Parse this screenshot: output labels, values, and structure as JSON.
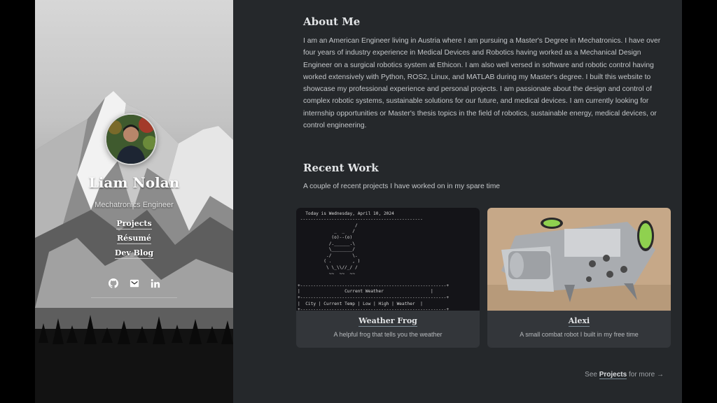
{
  "profile": {
    "name": "Liam Nolan",
    "role": "Mechatronics Engineer"
  },
  "nav": {
    "items": [
      {
        "label": "Projects"
      },
      {
        "label": "Résumé"
      },
      {
        "label": "Dev Blog"
      }
    ]
  },
  "social": {
    "icons": [
      "github-icon",
      "email-icon",
      "linkedin-icon"
    ]
  },
  "about": {
    "title": "About Me",
    "text": "I am an American Engineer living in Austria where I am pursuing a Master's Degree in Mechatronics. I have over four years of industry experience in Medical Devices and Robotics having worked as a Mechanical Design Engineer on a surgical robotics system at Ethicon. I am also well versed in software and robotic control having worked extensively with Python, ROS2, Linux, and MATLAB during my Master's degree. I built this website to showcase my professional experience and personal projects. I am passionate about the design and control of complex robotic systems, sustainable solutions for our future, and medical devices. I am currently looking for internship opportunities or Master's thesis topics in the field of robotics, sustainable energy, medical devices, or control engineering."
  },
  "recent": {
    "title": "Recent Work",
    "subtitle": "A couple of recent projects I have worked on in my spare time",
    "cards": [
      {
        "title": "Weather Frog",
        "description": "A helpful frog that tells you the weather",
        "terminal_date": "Today is Wednesday, April 10, 2024",
        "terminal_table_title": "Current Weather",
        "terminal_columns": "City | Current Temp | Low | High | Weather"
      },
      {
        "title": "Alexi",
        "description": "A small combat robot I built in my free time"
      }
    ]
  },
  "more": {
    "prefix": "See",
    "link": "Projects",
    "suffix": "for more →"
  },
  "colors": {
    "background": "#25282b",
    "card": "#33363a",
    "text": "#c4c7ca",
    "heading": "#e2e4e6"
  }
}
